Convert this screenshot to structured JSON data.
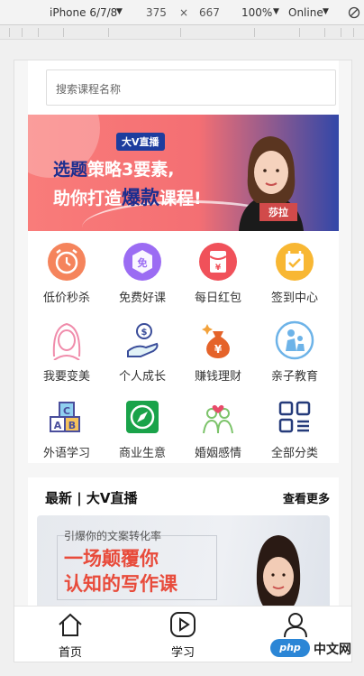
{
  "devtools": {
    "device": "iPhone 6/7/8",
    "width": "375",
    "times": "×",
    "height": "667",
    "zoom": "100%",
    "network": "Online"
  },
  "search": {
    "placeholder": "搜索课程名称"
  },
  "banner": {
    "badge": "大V直播",
    "line1_a": "选题",
    "line1_b": "策略3要素,",
    "line2_a": "助你打造",
    "line2_b": "爆款",
    "line2_c": "课程!",
    "name": "莎拉"
  },
  "categories": [
    {
      "label": "低价秒杀",
      "icon": "alarm-clock-icon"
    },
    {
      "label": "免费好课",
      "icon": "free-badge-icon"
    },
    {
      "label": "每日红包",
      "icon": "red-envelope-icon"
    },
    {
      "label": "签到中心",
      "icon": "check-calendar-icon"
    },
    {
      "label": "我要变美",
      "icon": "woman-face-icon"
    },
    {
      "label": "个人成长",
      "icon": "hand-coin-icon"
    },
    {
      "label": "赚钱理财",
      "icon": "money-bag-icon"
    },
    {
      "label": "亲子教育",
      "icon": "parent-child-icon"
    },
    {
      "label": "外语学习",
      "icon": "abc-blocks-icon"
    },
    {
      "label": "商业生意",
      "icon": "compass-icon"
    },
    {
      "label": "婚姻感情",
      "icon": "couple-heart-icon"
    },
    {
      "label": "全部分类",
      "icon": "grid-apps-icon"
    }
  ],
  "live": {
    "title": "最新 | 大V直播",
    "more": "查看更多",
    "card_sub": "引爆你的文案转化率",
    "card_line1": "一场颠覆你",
    "card_line2": "认知的写作课"
  },
  "tabs": [
    {
      "label": "首页",
      "icon": "home-icon"
    },
    {
      "label": "学习",
      "icon": "play-icon"
    },
    {
      "label": "",
      "icon": "user-icon"
    }
  ],
  "watermark": {
    "logo": "php",
    "text": "中文网"
  },
  "colors": {
    "accent_red": "#e84b3b",
    "banner_blue": "#1c2e8f"
  }
}
